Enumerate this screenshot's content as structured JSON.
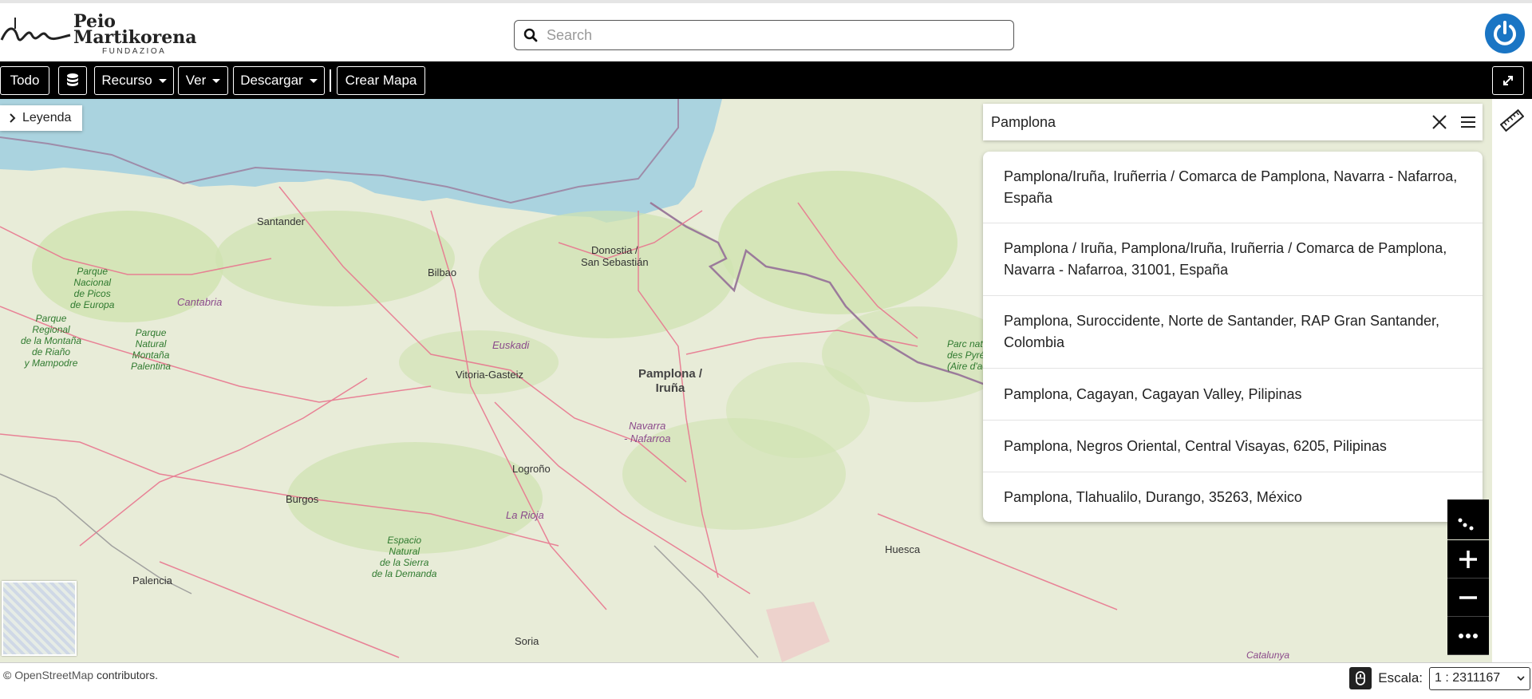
{
  "header": {
    "logo_line1": "Peio",
    "logo_line2": "Martikorena",
    "logo_sub": "FUNDAZIOA",
    "search_placeholder": "Search"
  },
  "toolbar": {
    "todo": "Todo",
    "recurso": "Recurso",
    "ver": "Ver",
    "descargar": "Descargar",
    "crear_mapa": "Crear Mapa"
  },
  "map": {
    "legend_label": "Leyenda",
    "labels": {
      "santander": "Santander",
      "bilbao": "Bilbao",
      "donostia": "Donostia /\nSan Sebastián",
      "vitoria": "Vitoria-Gasteiz",
      "pamplona": "Pamplona /\nIruña",
      "logrono": "Logroño",
      "burgos": "Burgos",
      "palencia": "Palencia",
      "soria": "Soria",
      "huesca": "Huesca",
      "cantabria": "Cantabria",
      "euskadi": "Euskadi",
      "navarra": "Navarra\n- Nafarroa",
      "larioja": "La Rioja",
      "catalunya": "Catalunya",
      "picos": "Parque\nNacional\nde Picos\nde Europa",
      "regional": "Parque\nRegional\nde la Montaña\nde Riaño\ny Mampodre",
      "natural": "Parque\nNatural\nMontaña\nPalentina",
      "demanda": "Espacio\nNatural\nde la Sierra\nde la Demanda",
      "pyrenees": "Parc nat\ndes Pyré\n(Aire d'adi"
    }
  },
  "geosearch": {
    "query": "Pamplona",
    "results": [
      "Pamplona/Iruña, Iruñerria / Comarca de Pamplona, Navarra - Nafarroa, España",
      "Pamplona / Iruña, Pamplona/Iruña, Iruñerria / Comarca de Pamplona, Navarra - Nafarroa, 31001, España",
      "Pamplona, Suroccidente, Norte de Santander, RAP Gran Santander, Colombia",
      "Pamplona, Cagayan, Cagayan Valley, Pilipinas",
      "Pamplona, Negros Oriental, Central Visayas, 6205, Pilipinas",
      "Pamplona, Tlahualilo, Durango, 35263, México"
    ]
  },
  "footer": {
    "attribution_prefix": "© ",
    "attribution_osm": "OpenStreetMap",
    "attribution_suffix": " contributors.",
    "scale_label": "Escala:",
    "scale_value": "1 : 2311167"
  },
  "colors": {
    "sea": "#aad3df",
    "land": "#e8ecd8",
    "forest": "#cfe3b0",
    "road": "#e8778f",
    "border": "#9b7b9b",
    "brand_blue": "#1a75c4"
  }
}
